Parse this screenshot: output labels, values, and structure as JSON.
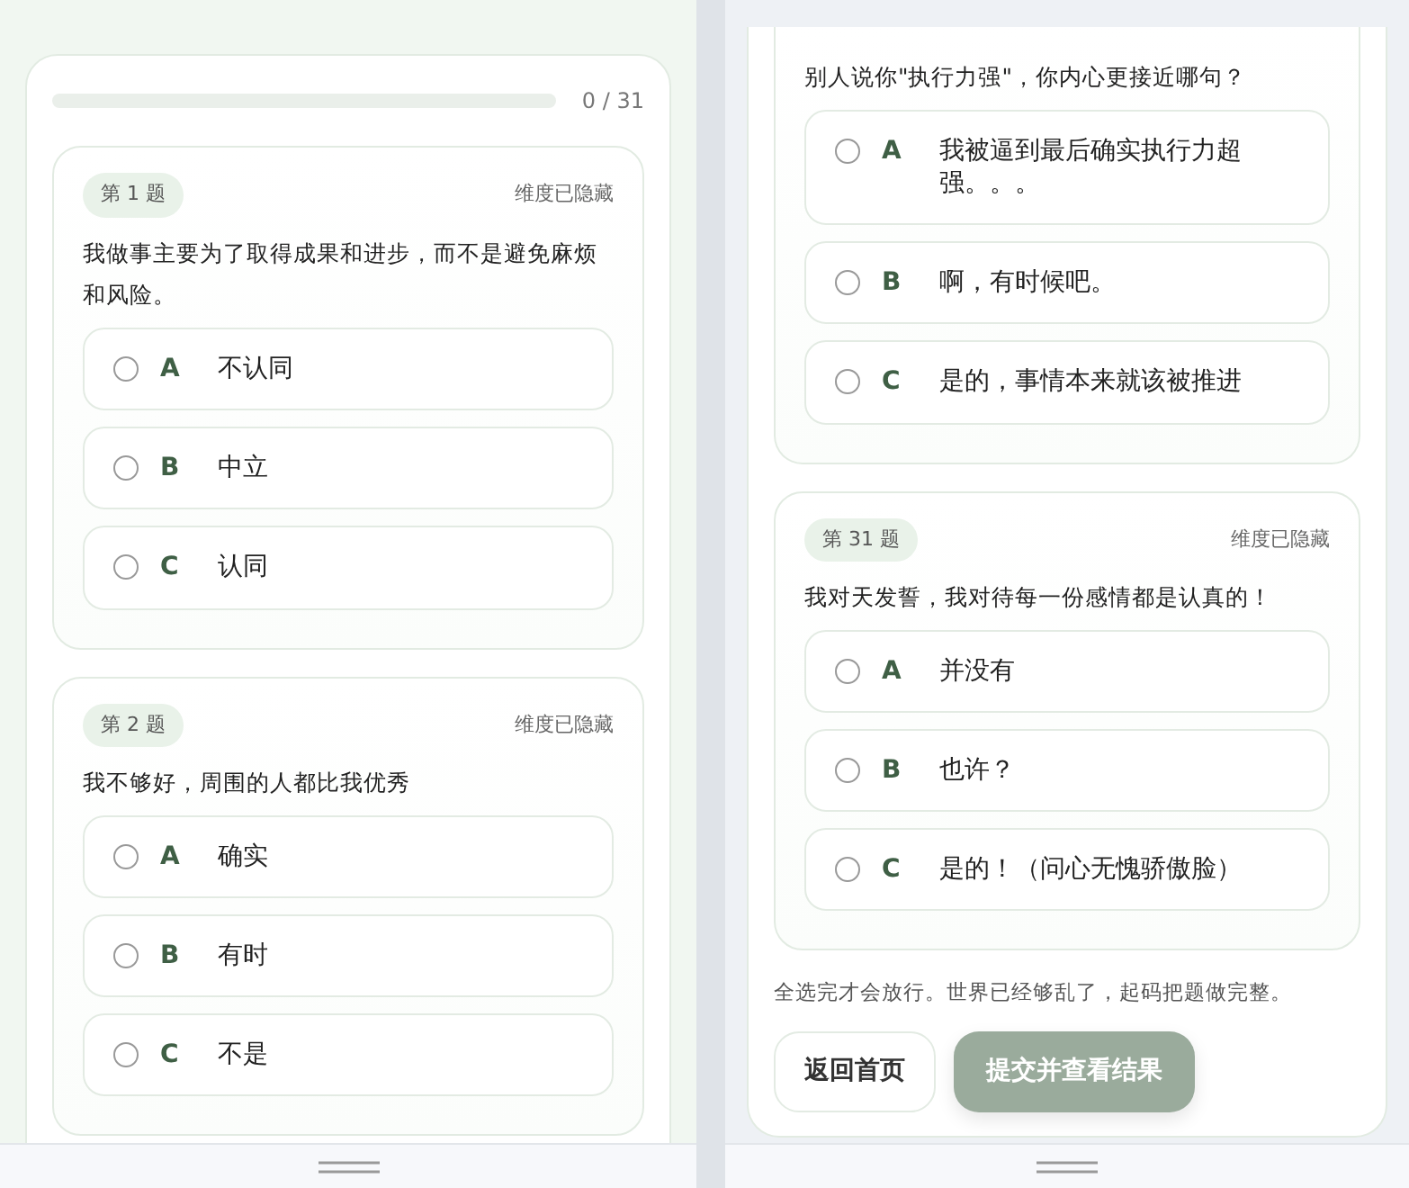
{
  "left_screen": {
    "progress": {
      "level": 0,
      "count": "0 / 31"
    },
    "questions": [
      {
        "badge": "第 1 题",
        "tag": "维度已隐藏",
        "text": "我做事主要为了取得成果和进步，而不是避免麻烦和风险。",
        "options": [
          {
            "letter": "A",
            "label": "不认同",
            "selected": false
          },
          {
            "letter": "B",
            "label": "中立",
            "selected": false
          },
          {
            "letter": "C",
            "label": "认同",
            "selected": false
          }
        ]
      },
      {
        "badge": "第 2 题",
        "tag": "维度已隐藏",
        "text": "我不够好，周围的人都比我优秀",
        "options": [
          {
            "letter": "A",
            "label": "确实",
            "selected": false
          },
          {
            "letter": "B",
            "label": "有时",
            "selected": false
          },
          {
            "letter": "C",
            "label": "不是",
            "selected": false
          }
        ]
      }
    ]
  },
  "right_screen": {
    "questions": [
      {
        "text": "别人说你\"执行力强\"，你内心更接近哪句？",
        "options": [
          {
            "letter": "A",
            "label": "我被逼到最后确实执行力超强。。。",
            "selected": false
          },
          {
            "letter": "B",
            "label": "啊，有时候吧。",
            "selected": false
          },
          {
            "letter": "C",
            "label": "是的，事情本来就该被推进",
            "selected": false
          }
        ]
      },
      {
        "badge": "第 31 题",
        "tag": "维度已隐藏",
        "text": "我对天发誓，我对待每一份感情都是认真的！",
        "options": [
          {
            "letter": "A",
            "label": "并没有",
            "selected": false
          },
          {
            "letter": "B",
            "label": "也许？",
            "selected": false
          },
          {
            "letter": "C",
            "label": "是的！（问心无愧骄傲脸）",
            "selected": false
          }
        ]
      }
    ],
    "note": "全选完才会放行。世界已经够乱了，起码把题做完整。",
    "buttons": [
      {
        "label": "返回首页",
        "kind": "secondary",
        "disabled": false
      },
      {
        "label": "提交并查看结果",
        "kind": "primary",
        "disabled": true
      }
    ]
  }
}
